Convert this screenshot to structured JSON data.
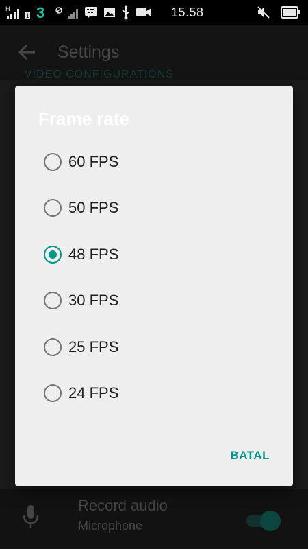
{
  "status_bar": {
    "time": "15.58",
    "network_label": "3",
    "icons": [
      "signal-h-icon",
      "signal-icon",
      "three-network-icon",
      "blocked-icon",
      "bbm-chat-icon",
      "gallery-icon",
      "usb-icon",
      "video-camera-icon",
      "mute-icon",
      "battery-icon"
    ]
  },
  "app_bar": {
    "title": "Settings",
    "back_icon": "back-arrow-icon"
  },
  "underlying": {
    "section_header": "VIDEO CONFIGURATIONS",
    "record_audio": {
      "title": "Record audio",
      "subtitle": "Microphone",
      "switch_on": true,
      "icon": "microphone-icon"
    }
  },
  "dialog": {
    "title": "Frame rate",
    "options": [
      {
        "label": "60 FPS",
        "checked": false
      },
      {
        "label": "50 FPS",
        "checked": false
      },
      {
        "label": "48 FPS",
        "checked": true
      },
      {
        "label": "30 FPS",
        "checked": false
      },
      {
        "label": "25 FPS",
        "checked": false
      },
      {
        "label": "24 FPS",
        "checked": false
      }
    ],
    "cancel_label": "BATAL"
  },
  "colors": {
    "accent": "#009688",
    "dialog_background": "#eeeeee",
    "status_bar": "#000000"
  }
}
